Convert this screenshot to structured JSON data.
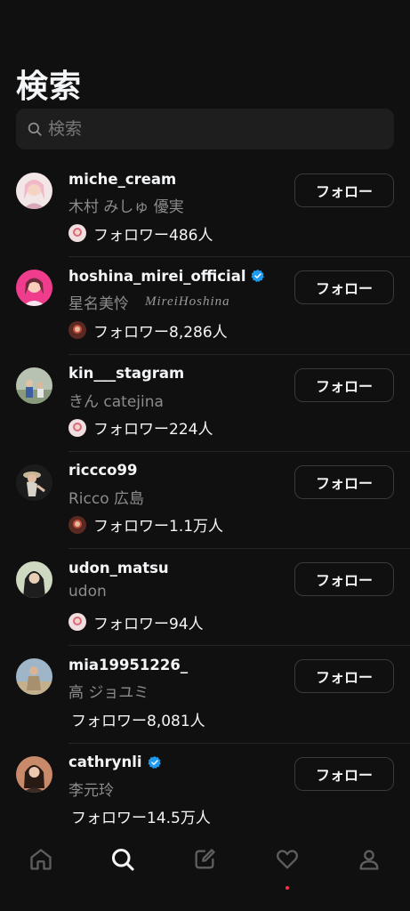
{
  "header": {
    "title": "検索"
  },
  "search": {
    "placeholder": "検索"
  },
  "follow_label": "フォロー",
  "users": [
    {
      "username": "miche_cream",
      "fullname": "木村 みしゅ 優実",
      "signature": "",
      "verified": false,
      "followers": "フォロワー486人",
      "mini_avatar": true
    },
    {
      "username": "hoshina_mirei_official",
      "fullname": "星名美怜",
      "signature": "MireiHoshina",
      "verified": true,
      "followers": "フォロワー8,286人",
      "mini_avatar": true
    },
    {
      "username": "kin___stagram",
      "fullname": "きん catejina",
      "signature": "",
      "verified": false,
      "followers": "フォロワー224人",
      "mini_avatar": true
    },
    {
      "username": "riccco99",
      "fullname": "Ricco 広島",
      "signature": "",
      "verified": false,
      "followers": "フォロワー1.1万人",
      "mini_avatar": true
    },
    {
      "username": "udon_matsu",
      "fullname": "udon",
      "signature": "",
      "verified": false,
      "followers": "フォロワー94人",
      "mini_avatar": true
    },
    {
      "username": "mia19951226_",
      "fullname": "高 ジョユミ",
      "signature": "",
      "verified": false,
      "followers": "フォロワー8,081人",
      "mini_avatar": false
    },
    {
      "username": "cathrynli",
      "fullname": "李元玲",
      "signature": "",
      "verified": true,
      "followers": "フォロワー14.5万人",
      "mini_avatar": false
    }
  ],
  "nav": [
    {
      "icon": "home-icon",
      "active": false
    },
    {
      "icon": "search-icon",
      "active": true
    },
    {
      "icon": "compose-icon",
      "active": false
    },
    {
      "icon": "heart-icon",
      "active": false,
      "badge": true
    },
    {
      "icon": "profile-icon",
      "active": false
    }
  ],
  "colors": {
    "background": "#101010",
    "verified": "#1d9bf0",
    "notification": "#ff3040"
  }
}
